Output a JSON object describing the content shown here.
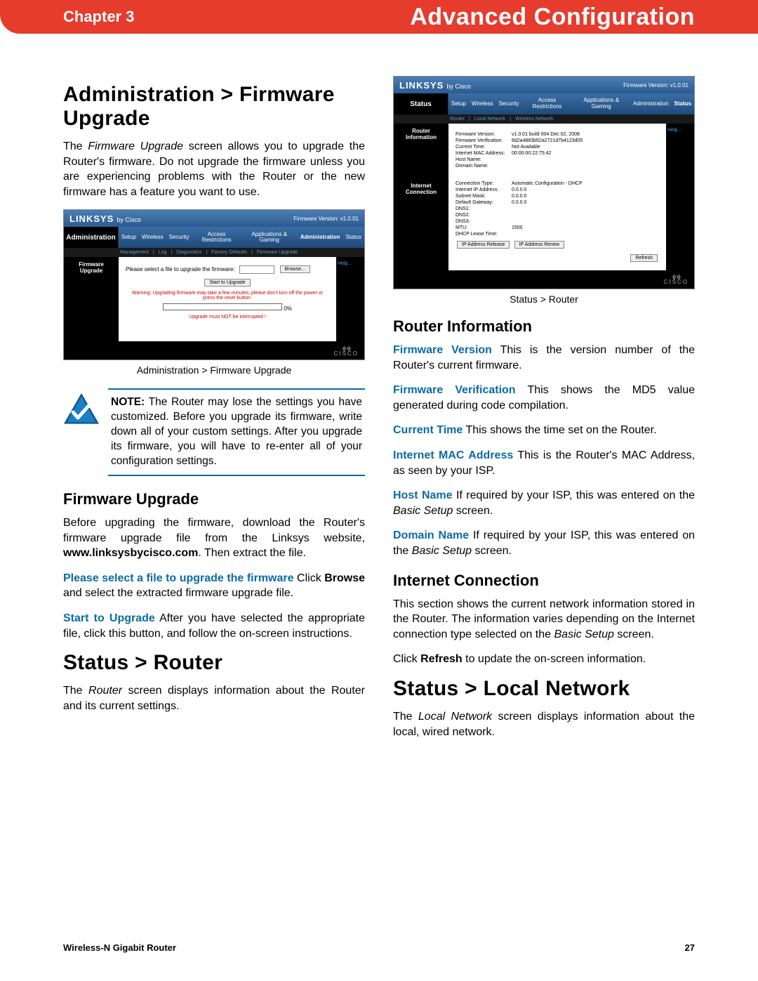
{
  "header": {
    "chapter": "Chapter 3",
    "title": "Advanced Configuration"
  },
  "left": {
    "h1": "Administration > Firmware Upgrade",
    "intro_pre": "The ",
    "intro_em": "Firmware Upgrade",
    "intro_post": " screen allows you to upgrade the Router's firmware. Do not upgrade the firmware unless you are experiencing problems with the Router or the new firmware has a feature you want to use.",
    "panel1": {
      "brand": "LINKSYS",
      "bycisco": "by Cisco",
      "fwver": "Firmware Version: v1.0.01",
      "side": "Administration",
      "tabs": [
        "Setup",
        "Wireless",
        "Security",
        "Access Restrictions",
        "Applications & Gaming",
        "Administration",
        "Status"
      ],
      "subnav": [
        "Management",
        "|",
        "Log",
        "|",
        "Diagnostics",
        "|",
        "Factory Defaults",
        "|",
        "Firmware Upgrade"
      ],
      "section": "Firmware Upgrade",
      "select_label": "Please select a file to upgrade the firmware:",
      "browse": "Browse...",
      "start": "Start to Upgrade",
      "warn": "Warning: Upgrading firmware may take a few minutes, please don't turn off the power or press the reset button.",
      "progress": "0%",
      "nointerrupt": "Upgrade must NOT be interrupted !",
      "help": "Help..."
    },
    "caption1": "Administration > Firmware Upgrade",
    "note_bold": "NOTE:",
    "note_text": " The Router may lose the settings you have customized. Before you upgrade its firmware, write down all of your custom settings. After you upgrade its firmware, you will have to re-enter all of your configuration settings.",
    "h2a": "Firmware Upgrade",
    "p2_pre": "Before upgrading the firmware, download the Router's firmware upgrade file from the Linksys website, ",
    "p2_link": "www.linksysbycisco.com",
    "p2_post": ". Then extract the file.",
    "p3_lead": "Please select a file to upgrade the firmware",
    "p3_rest": " Click ",
    "p3_bold": "Browse",
    "p3_end": " and select the extracted firmware upgrade file.",
    "p4_lead": "Start to Upgrade",
    "p4_rest": " After you have selected the appropriate file, click this button, and follow the on-screen instructions.",
    "h1b": "Status > Router",
    "p5_pre": "The ",
    "p5_em": "Router",
    "p5_post": " screen displays information about the Router and its current settings."
  },
  "right": {
    "panel2": {
      "brand": "LINKSYS",
      "bycisco": "by Cisco",
      "fwver": "Firmware Version: v1.0.01",
      "side": "Status",
      "tabs": [
        "Setup",
        "Wireless",
        "Security",
        "Access Restrictions",
        "Applications & Gaming",
        "Administration",
        "Status"
      ],
      "subnav": [
        "Router",
        "|",
        "Local Network",
        "|",
        "Wireless Network"
      ],
      "section1": "Router Information",
      "rows1": [
        {
          "k": "Firmware Version:",
          "v": "v1.0.01 build 004 Dec 02, 2008"
        },
        {
          "k": "Firmware Verification:",
          "v": "8d2a4883b52a2721d7b4123d05"
        },
        {
          "k": "Current Time:",
          "v": "Not Available"
        },
        {
          "k": "Internet MAC Address:",
          "v": "00:00:00:22:75:42"
        },
        {
          "k": "Host Name:",
          "v": ""
        },
        {
          "k": "Domain Name:",
          "v": ""
        }
      ],
      "section2": "Internet Connection",
      "rows2": [
        {
          "k": "Connection Type:",
          "v": "Automatic Configuration - DHCP"
        },
        {
          "k": "Internet IP Address:",
          "v": "0.0.0.0"
        },
        {
          "k": "Subnet Mask:",
          "v": "0.0.0.0"
        },
        {
          "k": "Default Gateway:",
          "v": "0.0.0.0"
        },
        {
          "k": "DNS1:",
          "v": ""
        },
        {
          "k": "DNS2:",
          "v": ""
        },
        {
          "k": "DNS3:",
          "v": ""
        },
        {
          "k": "MTU:",
          "v": "1500"
        },
        {
          "k": "DHCP Lease Time:",
          "v": ""
        }
      ],
      "btn_release": "IP Address Release",
      "btn_renew": "IP Address Renew",
      "btn_refresh": "Refresh",
      "help": "Help..."
    },
    "caption2": "Status > Router",
    "h2a": "Router Information",
    "items": [
      {
        "lead": "Firmware Version",
        "rest": " This is the version number of the Router's current firmware."
      },
      {
        "lead": "Firmware Verification",
        "rest": " This shows the MD5 value generated during code compilation."
      },
      {
        "lead": "Current Time",
        "rest": "  This shows the time set on the Router."
      },
      {
        "lead": "Internet MAC Address",
        "rest": "  This is the Router's MAC Address, as seen by your ISP."
      },
      {
        "lead": "Host Name",
        "rest": "  If required by your ISP, this was entered on the "
      },
      {
        "lead": "Domain Name",
        "rest": "  If required by your ISP, this was entered on the "
      }
    ],
    "basic_setup": "Basic Setup",
    "screen_word": " screen.",
    "h2b": "Internet Connection",
    "p_ic_pre": "This section shows the current network information stored in the Router. The information varies depending on the Internet connection type selected on the ",
    "p_ic_em": "Basic Setup",
    "p_ic_post": " screen.",
    "p_refresh_pre": "Click ",
    "p_refresh_bold": "Refresh",
    "p_refresh_post": " to update the on-screen information.",
    "h1c": "Status > Local Network",
    "p_ln_pre": "The ",
    "p_ln_em": "Local Network",
    "p_ln_post": " screen displays information about the local, wired network."
  },
  "footer": {
    "product": "Wireless-N Gigabit Router",
    "page": "27"
  }
}
